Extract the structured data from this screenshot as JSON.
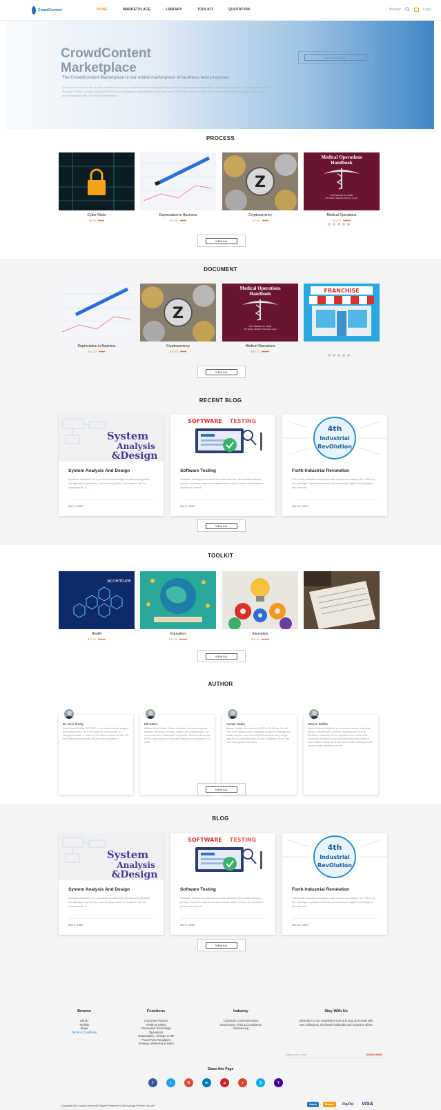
{
  "nav": {
    "logo_text": "CrowdContent",
    "items": [
      "HOME",
      "MARKETPLACE",
      "LIBRARY",
      "TOOLKIT",
      "QUOTATION"
    ],
    "search_label": "Browse",
    "login": "Login"
  },
  "hero": {
    "title_line1": "CrowdContent",
    "title_line2": "Marketplace",
    "subtitle": "The CrowdContent Marketplace is our online marketplace of business best practices.",
    "body": "Learn how to improve the growth and efficiency of your organization by leveraging Flevy's library of best practice frameworks, templates, and tools. Our documents are of the same caliber as those produced by top-tier management consulting firms like McKinsey, BCG, Bain, and Accenture. Most were developed by seasoned executives and consultants with 20+ years of experience.",
    "button": "Start Here Today"
  },
  "process": {
    "title": "PROCESS",
    "items": [
      {
        "name": "Cyber Risks",
        "price": "$5.01",
        "old": "$430"
      },
      {
        "name": "Depreciation in Business",
        "price": "$12.87",
        "old": "$980"
      },
      {
        "name": "Cryptocurrency",
        "price": "$10.53",
        "old": "$900"
      },
      {
        "name": "Medical Operations",
        "price": "$25.73",
        "old": "$2200"
      }
    ],
    "view_all": "VIEW ALL"
  },
  "document": {
    "title": "DOCUMENT",
    "items": [
      {
        "name": "Depreciation in Business",
        "price": "$12.87",
        "old": "$980"
      },
      {
        "name": "Cryptocurrency",
        "price": "$10.53",
        "old": "$900"
      },
      {
        "name": "Medical Operations",
        "price": "$25.73",
        "old": "$2200"
      },
      {
        "name": "",
        "price": "",
        "old": ""
      }
    ],
    "franchise": "FRANCHISE",
    "view_all": "VIEW ALL"
  },
  "medical_cover": {
    "line1": "Medical Operations",
    "line2": "Handbook",
    "author": "CPT Michael W. Smith",
    "org": "US Army, Medical Service Corps"
  },
  "recent_blog": {
    "title": "RECENT BLOG",
    "posts": [
      {
        "title": "System Analysis And Design",
        "excerpt": "Systems Analysis It is a process of collecting and interpreting facts, identifying the problems, and decomposition of a system into its components. It...",
        "date": "Mar 9, 2020"
      },
      {
        "title": "Software Testing",
        "excerpt": "Software Testing is a method to check whether the actual software product matches expected requirements and to ensure that software product is Defect...",
        "date": "Mar 9, 2020"
      },
      {
        "title": "Forth Industrial Revolution",
        "excerpt": "The fourth industrial revolution, also known as Industry 4.0, refers to the marriage of physical assets and advanced digital technologies - the Internet...",
        "date": "Mar 10, 2020"
      }
    ],
    "view_all": "VIEW ALL"
  },
  "blog_art": {
    "sad1": "System",
    "sad2": "Analysis",
    "sad3": "&Design",
    "st1": "SOFTWARE",
    "st2": "TESTING",
    "ir1": "4th",
    "ir2": "Industrial",
    "ir3": "RevOlution"
  },
  "toolkit": {
    "title": "TOOLKIT",
    "items": [
      {
        "name": "Health",
        "price": "$37.15",
        "old": "$3160"
      },
      {
        "name": "Education",
        "price": "$14.04",
        "old": "$1200"
      },
      {
        "name": "Innovation",
        "price": "$14.04",
        "old": "$1200"
      },
      {
        "name": "",
        "price": "",
        "old": ""
      }
    ],
    "accenture": "accenture",
    "view_all": "VIEW ALL"
  },
  "author": {
    "title": "AUTHOR",
    "people": [
      {
        "name": "Dr. Devi Shetty",
        "bio": "Devi Prasad Shetty, MS FRCS, is an Indian cardiac surgeon and entrepreneur. He is the chairman and founder of Narayana Health, a chain of 21 medical centers in India. He has performed more than 15,000 heart operations."
      },
      {
        "name": "Bill Gates",
        "bio": "William Henry Gates III is an American business magnate, software developer, investor, author, and philanthropist. He is a co-founder of Microsoft Corporation. Microsoft launched its first retail version of Microsoft Windows on November 20, 1985."
      },
      {
        "name": "Ayman Sadiq",
        "bio": "Ayman Sadiq is the founder & CEO of 10 Minute School. This is the largest online education platform in Bangladesh which reaches more than 300,000 students every single day, the 10 completely free of cost. 10 Minute School has won many global accolades."
      },
      {
        "name": "Warren Buffett",
        "bio": "Warren Edward Buffett is an American investor, business tycoon, philanthropist, and the chairman and CEO of Berkshire Hathaway. He is considered one of the most successful investors in the world and has a net worth of over US$80.5 billion as of December 2020, making him the world's fourth-wealthiest person."
      }
    ],
    "view_all": "VIEW ALL"
  },
  "blog": {
    "title": "BLOG",
    "posts": [
      {
        "title": "System Analysis And Design",
        "excerpt": "Systems Analysis It is a process of collecting and interpreting facts, identifying the problems, and decomposition of a system into its components. It...",
        "date": "Mar 9, 2020"
      },
      {
        "title": "Software Testing",
        "excerpt": "Software Testing is a method to check whether the actual software product matches expected requirements and to ensure that software product is Defect...",
        "date": "Mar 9, 2020"
      },
      {
        "title": "Forth Industrial Revolution",
        "excerpt": "The fourth industrial revolution, also known as Industry 4.0, refers to the marriage of physical assets and advanced digital technologies - the Internet...",
        "date": "Mar 10, 2020"
      }
    ],
    "view_all": "VIEW ALL"
  },
  "footer": {
    "browse": {
      "title": "Browse",
      "items": [
        "Library",
        "Toolkits",
        "Blogs",
        "Terms & Conditions"
      ]
    },
    "functions": {
      "title": "Functions",
      "items": [
        "Corporate Finance",
        "Health & Safety",
        "Information Technology",
        "Operations",
        "Organization, Change & HR",
        "PowerPoint Templates",
        "Strategy, Marketing & Sales"
      ]
    },
    "industry": {
      "title": "Industry",
      "items": [
        "Corporate Communications",
        "Governance, Risk & Compliance",
        "Outsourcing"
      ]
    },
    "stay": {
      "title": "Stay With Us",
      "text": "Subscribe to our newsletters now and stay up-to-date with new collections, the latest lookbooks and exclusive offers."
    },
    "newsletter_placeholder": "Enter your e-mail",
    "subscribe": "SUBSCRIBE",
    "share_title": "Share this Page",
    "social": [
      {
        "icon": "facebook-icon",
        "glyph": "f",
        "color": "#3b5998"
      },
      {
        "icon": "twitter-icon",
        "glyph": "t",
        "color": "#1da1f2"
      },
      {
        "icon": "google-icon",
        "glyph": "G",
        "color": "#dd4b39"
      },
      {
        "icon": "linkedin-icon",
        "glyph": "in",
        "color": "#0077b5"
      },
      {
        "icon": "pinterest-icon",
        "glyph": "p",
        "color": "#cb2027"
      },
      {
        "icon": "reddit-icon",
        "glyph": "r",
        "color": "#e0432b"
      },
      {
        "icon": "skype-icon",
        "glyph": "S",
        "color": "#00aff0"
      },
      {
        "icon": "yahoo-icon",
        "glyph": "Y",
        "color": "#410093"
      }
    ],
    "copyright": "Copyright @ CrowdContent All Rights Reserved | Technology Partner Skoder",
    "payments": [
      "Amex",
      "Master",
      "PayPal",
      "VISA"
    ]
  }
}
